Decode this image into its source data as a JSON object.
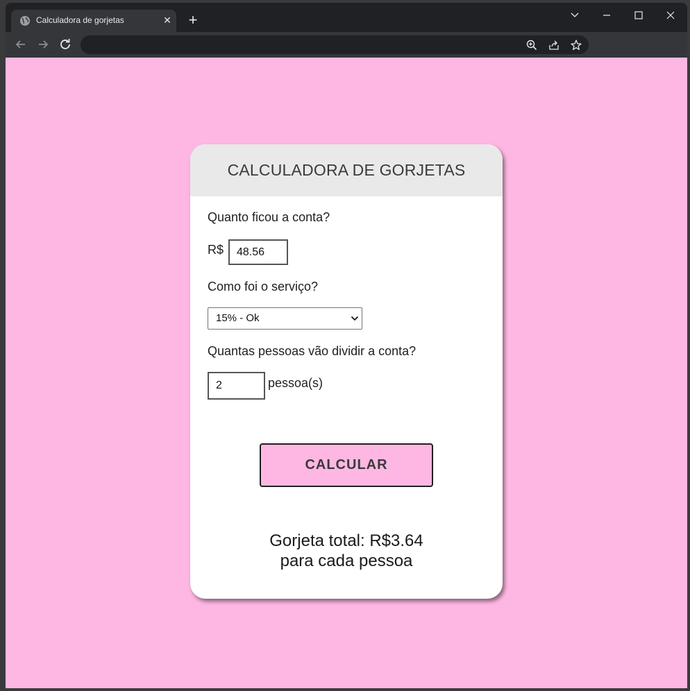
{
  "browser": {
    "tab_title": "Calculadora de gorjetas",
    "address": ""
  },
  "app": {
    "title": "CALCULADORA DE GORJETAS",
    "bill_question": "Quanto ficou a conta?",
    "currency": "R$",
    "bill_value": "48.56",
    "service_question": "Como foi o serviço?",
    "service_selected": "15% - Ok",
    "people_question": "Quantas pessoas vão dividir a conta?",
    "people_value": "2",
    "people_unit": "pessoa(s)",
    "calc_label": "CALCULAR",
    "result_line1": "Gorjeta total: R$3.64",
    "result_line2": "para cada pessoa"
  },
  "colors": {
    "page_background": "#feb7e2",
    "button_background": "#feb7e2",
    "card_header": "#e9e9e9"
  }
}
